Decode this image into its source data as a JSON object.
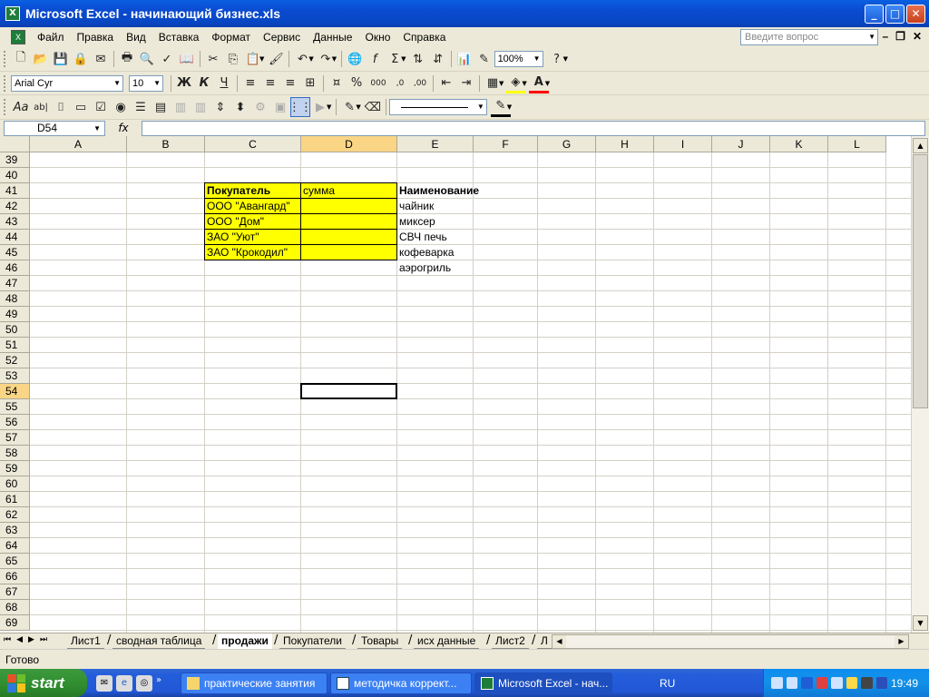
{
  "window": {
    "title": "Microsoft Excel - начинающий бизнес.xls",
    "app_icon": "excel-icon",
    "buttons": [
      "minimize",
      "maximize",
      "close"
    ]
  },
  "menu": {
    "items": [
      "Файл",
      "Правка",
      "Вид",
      "Вставка",
      "Формат",
      "Сервис",
      "Данные",
      "Окно",
      "Справка"
    ],
    "help_placeholder": "Введите вопрос"
  },
  "toolbar": {
    "zoom": "100%",
    "font_name": "Arial Cyr",
    "font_size": "10",
    "bold_label": "Ж",
    "italic_label": "К",
    "underline_label": "Ч",
    "percent_label": "%",
    "thousands_label": "000"
  },
  "formula_bar": {
    "name_box": "D54",
    "fx_label": "fx",
    "value": ""
  },
  "grid": {
    "columns": [
      "A",
      "B",
      "C",
      "D",
      "E",
      "F",
      "G",
      "H",
      "I",
      "J",
      "K",
      "L"
    ],
    "active_column": "D",
    "rows": [
      39,
      40,
      41,
      42,
      43,
      44,
      45,
      46,
      47,
      48,
      49,
      50,
      51,
      52,
      53,
      54,
      55,
      56,
      57,
      58,
      59,
      60,
      61,
      62,
      63,
      64,
      65,
      66,
      67,
      68,
      69
    ],
    "active_row": 54,
    "cells": [
      {
        "ref": "C41",
        "value": "Покупатель",
        "bold": true,
        "fill": "#ffff00"
      },
      {
        "ref": "D41",
        "value": "сумма",
        "bold": false,
        "fill": "#ffff00"
      },
      {
        "ref": "E41",
        "value": "Наименование",
        "bold": true,
        "fill": ""
      },
      {
        "ref": "C42",
        "value": "ООО \"Авангард\"",
        "bold": false,
        "fill": "#ffff00"
      },
      {
        "ref": "D42",
        "value": "",
        "bold": false,
        "fill": "#ffff00"
      },
      {
        "ref": "E42",
        "value": "чайник",
        "bold": false,
        "fill": ""
      },
      {
        "ref": "C43",
        "value": "ООО \"Дом\"",
        "bold": false,
        "fill": "#ffff00"
      },
      {
        "ref": "D43",
        "value": "",
        "bold": false,
        "fill": "#ffff00"
      },
      {
        "ref": "E43",
        "value": "миксер",
        "bold": false,
        "fill": ""
      },
      {
        "ref": "C44",
        "value": "ЗАО \"Уют\"",
        "bold": false,
        "fill": "#ffff00"
      },
      {
        "ref": "D44",
        "value": "",
        "bold": false,
        "fill": "#ffff00"
      },
      {
        "ref": "E44",
        "value": "СВЧ печь",
        "bold": false,
        "fill": ""
      },
      {
        "ref": "C45",
        "value": "ЗАО \"Крокодил\"",
        "bold": false,
        "fill": "#ffff00"
      },
      {
        "ref": "D45",
        "value": "",
        "bold": false,
        "fill": "#ffff00"
      },
      {
        "ref": "E45",
        "value": "кофеварка",
        "bold": false,
        "fill": ""
      },
      {
        "ref": "E46",
        "value": "аэрогриль",
        "bold": false,
        "fill": ""
      }
    ]
  },
  "sheets": {
    "tabs": [
      "Лист1",
      "сводная таблица",
      "продажи",
      "Покупатели",
      "Товары",
      "исх данные",
      "Лист2",
      "Л"
    ],
    "active": "продажи"
  },
  "status": {
    "text": "Готово"
  },
  "taskbar": {
    "start_label": "start",
    "items": [
      {
        "label": "практические занятия",
        "icon": "folder-icon"
      },
      {
        "label": "методичка коррект...",
        "icon": "word-icon"
      },
      {
        "label": "Microsoft Excel - нач...",
        "icon": "excel-icon"
      }
    ],
    "language": "RU",
    "clock": "19:49"
  }
}
